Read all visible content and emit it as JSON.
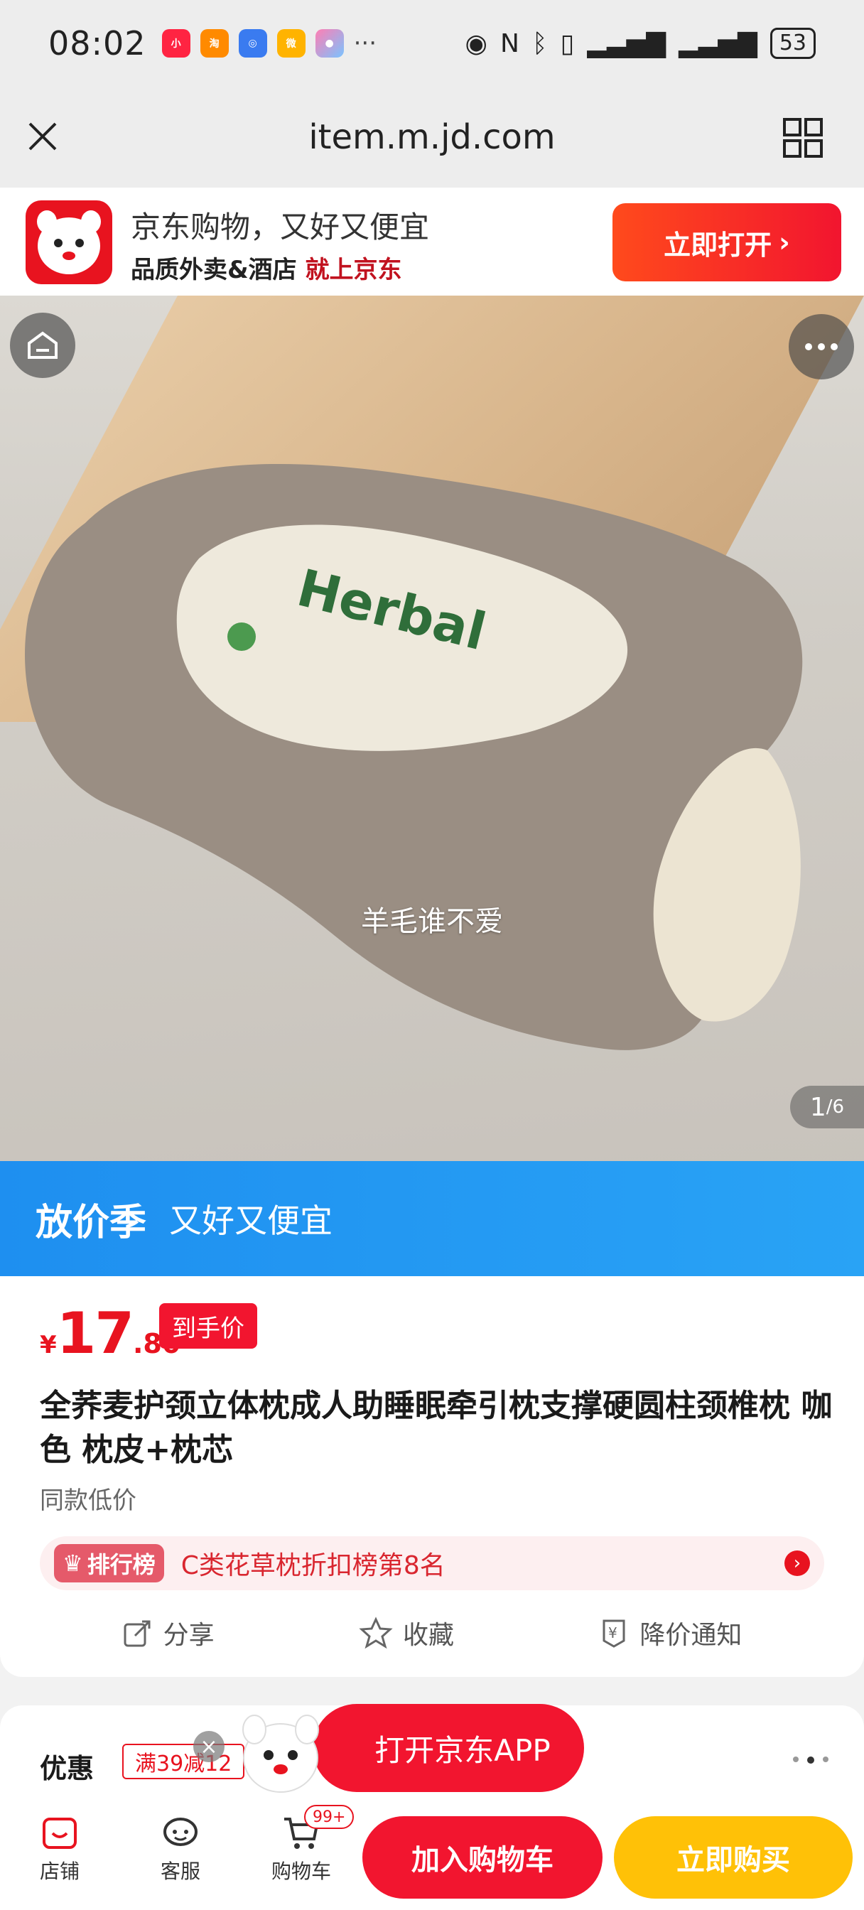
{
  "status_bar": {
    "time": "08:02",
    "app_icons": [
      "xiaohongshu-icon",
      "taobao-icon",
      "browser-icon",
      "weibo-icon",
      "photos-icon"
    ],
    "more": "···",
    "battery": "53"
  },
  "url_bar": {
    "url": "item.m.jd.com"
  },
  "app_banner": {
    "title": "京东购物，又好又便宜",
    "subtitle_prefix": "品质外卖&酒店",
    "subtitle_highlight": "就上京东",
    "open_button": "立即打开"
  },
  "hero": {
    "product_text_brand": "Herbal",
    "caption": "羊毛谁不爱",
    "pager_current": "1",
    "pager_total": "/6"
  },
  "promo_banner": {
    "main": "放价季",
    "sub": "又好又便宜"
  },
  "product": {
    "currency": "¥",
    "price_int": "17",
    "price_dec": ".80",
    "price_tag": "到手价",
    "title": "全荞麦护颈立体枕成人助睡眠牵引枕支撑硬圆柱颈椎枕 咖色 枕皮+枕芯",
    "low_price_note": "同款低价",
    "ranking_badge": "排行榜",
    "ranking_text": "C类花草枕折扣榜第8名",
    "actions": {
      "share": "分享",
      "favorite": "收藏",
      "price_alert": "降价通知"
    }
  },
  "discount": {
    "label": "优惠",
    "coupon": "满39减12"
  },
  "floating": {
    "open_app": "打开京东APP"
  },
  "bottom_bar": {
    "shop": "店铺",
    "service": "客服",
    "cart": "购物车",
    "cart_badge": "99+",
    "add_to_cart": "加入购物车",
    "buy_now": "立即购买"
  },
  "colors": {
    "jd_red": "#f2152f",
    "buy_yellow": "#ffc107",
    "promo_blue": "#1e8ff0"
  }
}
